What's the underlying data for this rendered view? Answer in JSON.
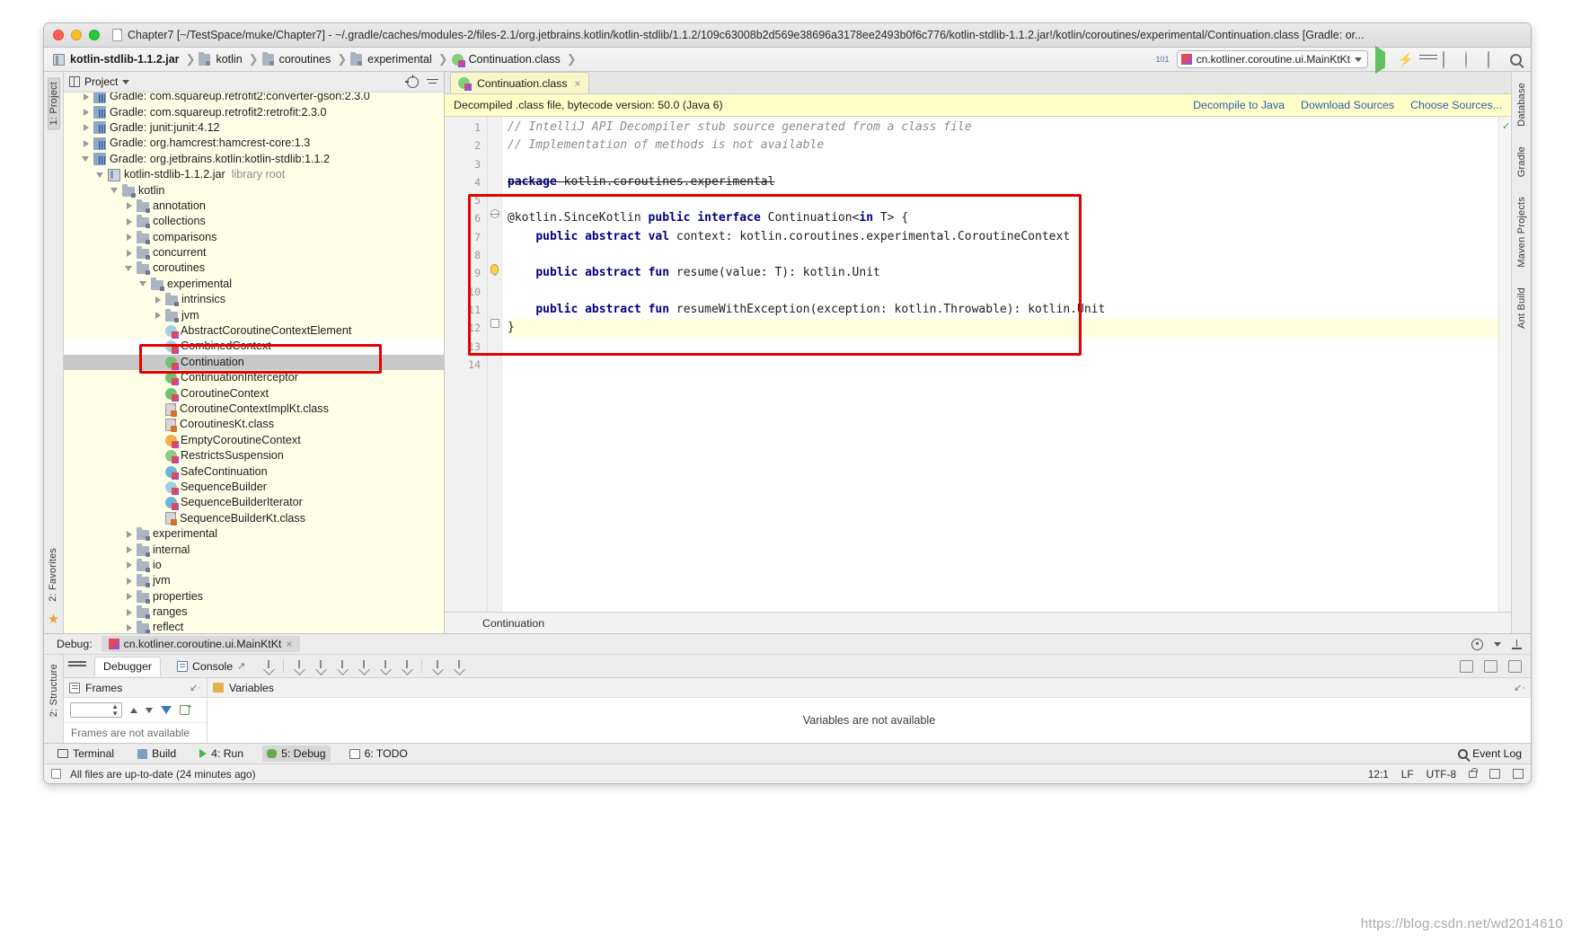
{
  "window": {
    "title": "Chapter7 [~/TestSpace/muke/Chapter7] - ~/.gradle/caches/modules-2/files-2.1/org.jetbrains.kotlin/kotlin-stdlib/1.1.2/109c63008b2d569e38696a3178ee2493b0f6c776/kotlin-stdlib-1.1.2.jar!/kotlin/coroutines/experimental/Continuation.class [Gradle: or..."
  },
  "breadcrumb": {
    "items": [
      {
        "label": "kotlin-stdlib-1.1.2.jar",
        "icon": "jar-icon",
        "bold": true
      },
      {
        "label": "kotlin",
        "icon": "package-icon",
        "bold": false
      },
      {
        "label": "coroutines",
        "icon": "package-icon",
        "bold": false
      },
      {
        "label": "experimental",
        "icon": "package-icon",
        "bold": false
      },
      {
        "label": "Continuation.class",
        "icon": "kotlin-class-icon",
        "bold": false
      }
    ]
  },
  "toolbar": {
    "run_configuration": "cn.kotliner.coroutine.ui.MainKtKt",
    "run_button": "run-icon",
    "run_with_coverage_button": "bolt-icon",
    "debug_button": "debug-icon",
    "stop_button": "stop-icon",
    "updates_badge": "101",
    "search_button": "search-icon"
  },
  "left_rail": {
    "top": [
      "1: Project"
    ],
    "bottom": [
      "2: Favorites"
    ]
  },
  "right_rail": {
    "items": [
      "Database",
      "Gradle",
      "Maven Projects",
      "Ant Build"
    ]
  },
  "project_panel": {
    "header_title": "Project",
    "locate_icon": "target-icon",
    "collapse_icon": "collapse-all-icon",
    "tree": [
      {
        "indent": 1,
        "arrow": "closed",
        "icon": "library-icon",
        "label": "Gradle: com.squareup.retrofit2:converter-gson:2.3.0",
        "sub": "",
        "state": "clipped"
      },
      {
        "indent": 1,
        "arrow": "closed",
        "icon": "library-icon",
        "label": "Gradle: com.squareup.retrofit2:retrofit:2.3.0",
        "sub": "",
        "state": "normal"
      },
      {
        "indent": 1,
        "arrow": "closed",
        "icon": "library-icon",
        "label": "Gradle: junit:junit:4.12",
        "sub": "",
        "state": "normal"
      },
      {
        "indent": 1,
        "arrow": "closed",
        "icon": "library-icon",
        "label": "Gradle: org.hamcrest:hamcrest-core:1.3",
        "sub": "",
        "state": "normal"
      },
      {
        "indent": 1,
        "arrow": "open",
        "icon": "library-icon",
        "label": "Gradle: org.jetbrains.kotlin:kotlin-stdlib:1.1.2",
        "sub": "",
        "state": "normal"
      },
      {
        "indent": 2,
        "arrow": "open",
        "icon": "jar-icon",
        "label": "kotlin-stdlib-1.1.2.jar",
        "sub": "library root",
        "state": "normal"
      },
      {
        "indent": 3,
        "arrow": "open",
        "icon": "package-icon",
        "label": "kotlin",
        "sub": "",
        "state": "normal"
      },
      {
        "indent": 4,
        "arrow": "closed",
        "icon": "package-icon",
        "label": "annotation",
        "sub": "",
        "state": "normal"
      },
      {
        "indent": 4,
        "arrow": "closed",
        "icon": "package-icon",
        "label": "collections",
        "sub": "",
        "state": "normal"
      },
      {
        "indent": 4,
        "arrow": "closed",
        "icon": "package-icon",
        "label": "comparisons",
        "sub": "",
        "state": "normal"
      },
      {
        "indent": 4,
        "arrow": "closed",
        "icon": "package-icon",
        "label": "concurrent",
        "sub": "",
        "state": "normal"
      },
      {
        "indent": 4,
        "arrow": "open",
        "icon": "package-icon",
        "label": "coroutines",
        "sub": "",
        "state": "normal"
      },
      {
        "indent": 5,
        "arrow": "open",
        "icon": "package-icon",
        "label": "experimental",
        "sub": "",
        "state": "normal"
      },
      {
        "indent": 6,
        "arrow": "closed",
        "icon": "package-icon",
        "label": "intrinsics",
        "sub": "",
        "state": "normal"
      },
      {
        "indent": 6,
        "arrow": "closed",
        "icon": "package-icon",
        "label": "jvm",
        "sub": "",
        "state": "normal"
      },
      {
        "indent": 6,
        "arrow": "none",
        "icon": "class-bluepale",
        "label": "AbstractCoroutineContextElement",
        "sub": "",
        "state": "normal"
      },
      {
        "indent": 6,
        "arrow": "none",
        "icon": "class-bluepale",
        "label": "CombinedContext",
        "sub": "",
        "state": "white"
      },
      {
        "indent": 6,
        "arrow": "none",
        "icon": "class-green",
        "label": "Continuation",
        "sub": "",
        "state": "selected"
      },
      {
        "indent": 6,
        "arrow": "none",
        "icon": "class-green",
        "label": "ContinuationInterceptor",
        "sub": "",
        "state": "normal"
      },
      {
        "indent": 6,
        "arrow": "none",
        "icon": "class-green",
        "label": "CoroutineContext",
        "sub": "",
        "state": "normal"
      },
      {
        "indent": 6,
        "arrow": "none",
        "icon": "file-class-icon",
        "label": "CoroutineContextImplKt.class",
        "sub": "",
        "state": "normal"
      },
      {
        "indent": 6,
        "arrow": "none",
        "icon": "file-class-icon",
        "label": "CoroutinesKt.class",
        "sub": "",
        "state": "normal"
      },
      {
        "indent": 6,
        "arrow": "none",
        "icon": "class-orange",
        "label": "EmptyCoroutineContext",
        "sub": "",
        "state": "normal"
      },
      {
        "indent": 6,
        "arrow": "none",
        "icon": "class-greenring",
        "label": "RestrictsSuspension",
        "sub": "",
        "state": "normal"
      },
      {
        "indent": 6,
        "arrow": "none",
        "icon": "class-blue",
        "label": "SafeContinuation",
        "sub": "",
        "state": "normal"
      },
      {
        "indent": 6,
        "arrow": "none",
        "icon": "class-bluepale",
        "label": "SequenceBuilder",
        "sub": "",
        "state": "normal"
      },
      {
        "indent": 6,
        "arrow": "none",
        "icon": "class-blue",
        "label": "SequenceBuilderIterator",
        "sub": "",
        "state": "normal"
      },
      {
        "indent": 6,
        "arrow": "none",
        "icon": "file-class-icon",
        "label": "SequenceBuilderKt.class",
        "sub": "",
        "state": "normal"
      },
      {
        "indent": 4,
        "arrow": "closed",
        "icon": "package-icon",
        "label": "experimental",
        "sub": "",
        "state": "normal"
      },
      {
        "indent": 4,
        "arrow": "closed",
        "icon": "package-icon",
        "label": "internal",
        "sub": "",
        "state": "normal"
      },
      {
        "indent": 4,
        "arrow": "closed",
        "icon": "package-icon",
        "label": "io",
        "sub": "",
        "state": "normal"
      },
      {
        "indent": 4,
        "arrow": "closed",
        "icon": "package-icon",
        "label": "jvm",
        "sub": "",
        "state": "normal"
      },
      {
        "indent": 4,
        "arrow": "closed",
        "icon": "package-icon",
        "label": "properties",
        "sub": "",
        "state": "normal"
      },
      {
        "indent": 4,
        "arrow": "closed",
        "icon": "package-icon",
        "label": "ranges",
        "sub": "",
        "state": "normal"
      },
      {
        "indent": 4,
        "arrow": "closed",
        "icon": "package-icon",
        "label": "reflect",
        "sub": "",
        "state": "normal"
      }
    ]
  },
  "editor": {
    "tab": {
      "label": "Continuation.class",
      "close": "×",
      "icon": "kotlin-class-icon"
    },
    "notice": {
      "text": "Decompiled .class file, bytecode version: 50.0 (Java 6)",
      "links": [
        "Decompile to Java",
        "Download Sources",
        "Choose Sources..."
      ]
    },
    "lines": [
      {
        "n": 1,
        "text": "// IntelliJ API Decompiler stub source generated from a class file",
        "style": "comment"
      },
      {
        "n": 2,
        "text": "// Implementation of methods is not available",
        "style": "comment"
      },
      {
        "n": 3,
        "text": "",
        "style": "plain"
      },
      {
        "n": 4,
        "text": "package kotlin.coroutines.experimental",
        "style": "package"
      },
      {
        "n": 5,
        "text": "",
        "style": "plain"
      },
      {
        "n": 6,
        "text": "@kotlin.SinceKotlin public interface Continuation<in T> {",
        "style": "decl"
      },
      {
        "n": 7,
        "text": "    public abstract val context: kotlin.coroutines.experimental.CoroutineContext",
        "style": "member"
      },
      {
        "n": 8,
        "text": "",
        "style": "plain"
      },
      {
        "n": 9,
        "text": "    public abstract fun resume(value: T): kotlin.Unit",
        "style": "member"
      },
      {
        "n": 10,
        "text": "",
        "style": "plain"
      },
      {
        "n": 11,
        "text": "    public abstract fun resumeWithException(exception: kotlin.Throwable): kotlin.Unit",
        "style": "member"
      },
      {
        "n": 12,
        "text": "}",
        "style": "plain"
      },
      {
        "n": 13,
        "text": "",
        "style": "plain"
      },
      {
        "n": 14,
        "text": "",
        "style": "plain"
      }
    ],
    "status_breadcrumb": "Continuation"
  },
  "debug": {
    "header_label": "Debug:",
    "session_name": "cn.kotliner.coroutine.ui.MainKtKt",
    "session_close": "×",
    "settings_icon": "gear-icon",
    "hide_icon": "hide-icon",
    "tabs": [
      {
        "label": "Debugger",
        "active": true
      },
      {
        "label": "Console",
        "active": false
      }
    ],
    "frames_title": "Frames",
    "variables_title": "Variables",
    "frames_message": "Frames are not available",
    "variables_message": "Variables are not available"
  },
  "tool_windows": {
    "items": [
      {
        "label": "Terminal",
        "icon": "terminal-icon",
        "active": false
      },
      {
        "label": "Build",
        "icon": "build-icon",
        "active": false
      },
      {
        "label": "4: Run",
        "icon": "run-icon",
        "active": false
      },
      {
        "label": "5: Debug",
        "icon": "debug-icon",
        "active": true
      },
      {
        "label": "6: TODO",
        "icon": "todo-icon",
        "active": false
      }
    ],
    "event_log": "Event Log"
  },
  "status_bar": {
    "message": "All files are up-to-date (24 minutes ago)",
    "caret": "12:1",
    "line_sep": "LF",
    "encoding": "UTF-8",
    "lock_icon": "lock-icon",
    "branch_icon": "branch-icon",
    "trash_icon": "trash-icon"
  },
  "watermark": "https://blog.csdn.net/wd2014610"
}
